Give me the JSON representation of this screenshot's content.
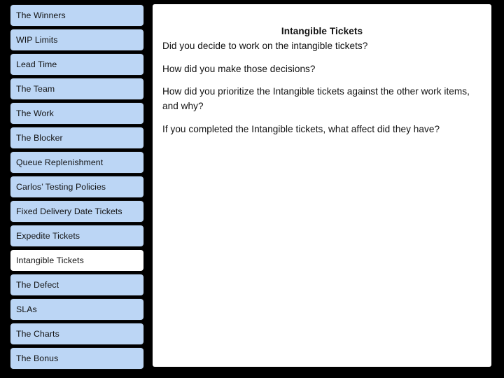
{
  "slide": {
    "background_color": "#000000",
    "panel_background": "#FFFFFF",
    "nav_item_color": "#BCD6F5",
    "nav_item_selected_color": "#FFFFFF"
  },
  "sidebar": {
    "items": [
      {
        "label": "The Winners",
        "selected": false
      },
      {
        "label": "WIP Limits",
        "selected": false
      },
      {
        "label": "Lead Time",
        "selected": false
      },
      {
        "label": "The Team",
        "selected": false
      },
      {
        "label": "The Work",
        "selected": false
      },
      {
        "label": "The Blocker",
        "selected": false
      },
      {
        "label": "Queue Replenishment",
        "selected": false
      },
      {
        "label": "Carlos’ Testing Policies",
        "selected": false
      },
      {
        "label": "Fixed Delivery Date Tickets",
        "selected": false
      },
      {
        "label": "Expedite Tickets",
        "selected": false
      },
      {
        "label": "Intangible Tickets",
        "selected": true
      },
      {
        "label": "The Defect",
        "selected": false
      },
      {
        "label": "SLAs",
        "selected": false
      },
      {
        "label": "The Charts",
        "selected": false
      },
      {
        "label": "The Bonus",
        "selected": false
      }
    ]
  },
  "main": {
    "title": "Intangible Tickets",
    "paragraphs": [
      "Did you decide to work on the intangible tickets?",
      "How did you make those decisions?",
      "How did you prioritize the Intangible tickets against the other work items, and why?",
      "If you completed the Intangible tickets, what affect did they have?"
    ]
  }
}
